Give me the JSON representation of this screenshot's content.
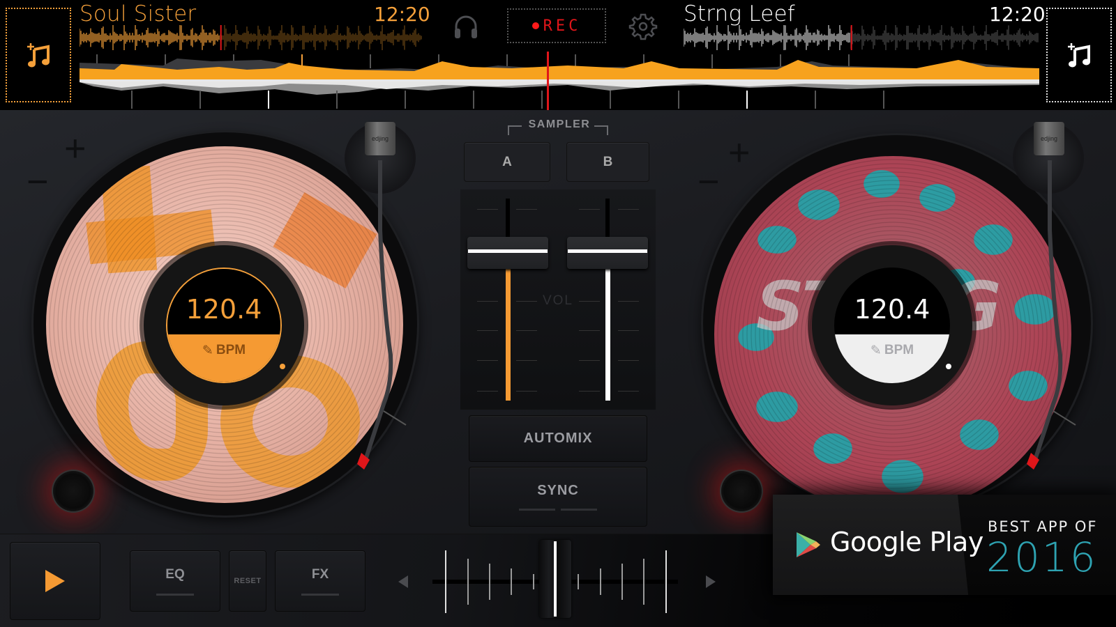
{
  "colors": {
    "deck_a_accent": "#f5a03a",
    "deck_b_accent": "#ffffff",
    "rec_red": "#e0161a",
    "badge_year": "#2ea3b2"
  },
  "deck_a": {
    "track_title": "Soul Sister",
    "time": "12:20",
    "load_icon": "add-music-icon",
    "bpm": "120.4",
    "bpm_label": "BPM",
    "pitch_plus": "+",
    "pitch_minus": "−",
    "playhead_progress": 0.41,
    "volume_level": 0.73
  },
  "deck_b": {
    "track_title": "Strng Leef",
    "time": "12:20",
    "load_icon": "add-music-icon",
    "bpm": "120.4",
    "bpm_label": "BPM",
    "pitch_plus": "+",
    "pitch_minus": "−",
    "playhead_progress": 0.47,
    "volume_level": 0.73
  },
  "topbar": {
    "headphones_icon": "headphones-icon",
    "rec_label": "REC",
    "settings_icon": "gear-icon"
  },
  "mixer": {
    "sampler_label": "SAMPLER",
    "sampler_a": "A",
    "sampler_b": "B",
    "vol_label": "VOL",
    "automix_label": "AUTOMIX",
    "sync_label": "SYNC",
    "crossfader_position": 0.5
  },
  "controls": {
    "play_icon": "play-icon",
    "eq_label": "EQ",
    "reset_label": "RESET",
    "fx_label": "FX"
  },
  "badge": {
    "store": "Google Play",
    "best_app": "BEST APP OF",
    "year": "2016"
  },
  "brand_on_cartridge": "edjing"
}
